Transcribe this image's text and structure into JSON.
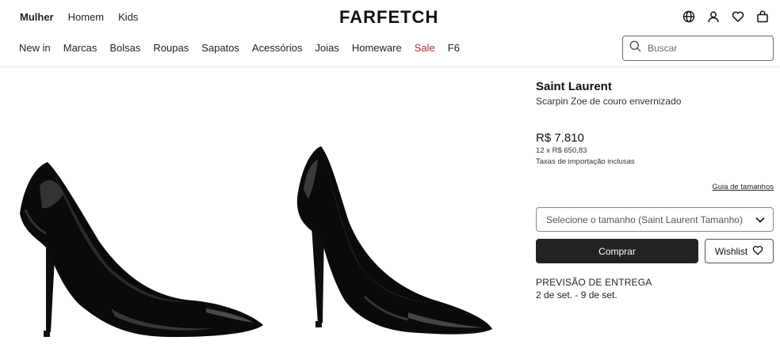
{
  "header": {
    "gender_nav": [
      "Mulher",
      "Homem",
      "Kids"
    ],
    "logo": "FARFETCH",
    "icons": [
      "globe-icon",
      "account-icon",
      "heart-icon",
      "bag-icon"
    ]
  },
  "category_nav": [
    "New in",
    "Marcas",
    "Bolsas",
    "Roupas",
    "Sapatos",
    "Acessórios",
    "Joias",
    "Homeware",
    "Sale",
    "F6"
  ],
  "search": {
    "placeholder": "Buscar"
  },
  "product": {
    "brand": "Saint Laurent",
    "name": "Scarpin Zoe de couro envernizado",
    "price": "R$ 7.810",
    "installments": "12 x R$ 650,83",
    "taxes": "Taxas de importação inclusas",
    "size_guide": "Guia de tamanhos",
    "size_select": "Selecione o tamanho (Saint Laurent Tamanho)",
    "buy_label": "Comprar",
    "wishlist_label": "Wishlist",
    "delivery_title": "PREVISÃO DE ENTREGA",
    "delivery_dates": "2 de set. - 9 de set."
  },
  "colors": {
    "sale": "#a7283a",
    "primary_button": "#222222"
  }
}
